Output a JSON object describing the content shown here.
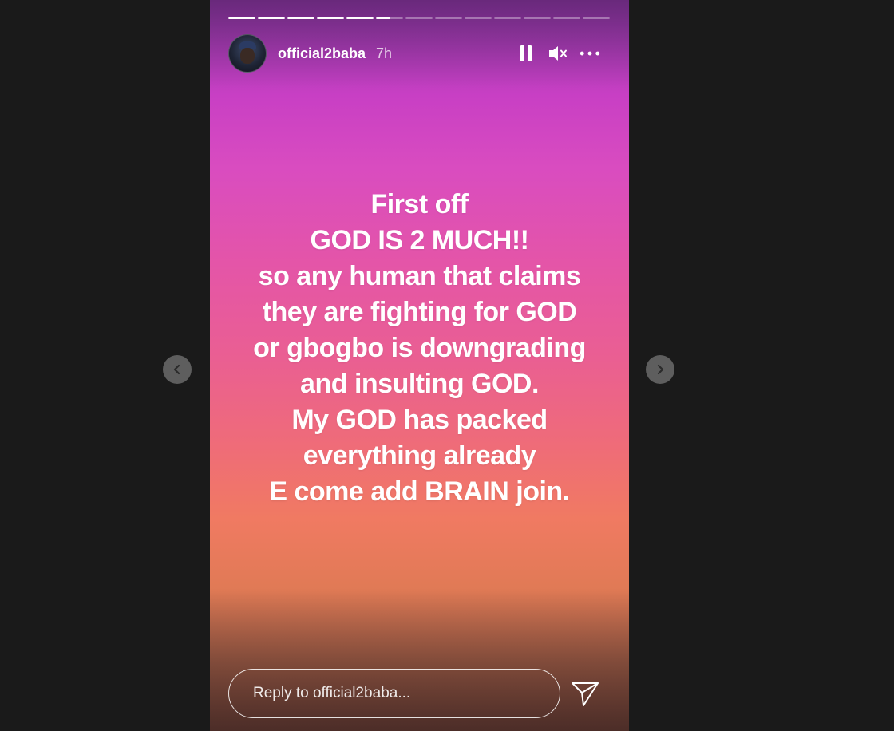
{
  "story": {
    "username": "official2baba",
    "time": "7h",
    "progress": {
      "segments": 13,
      "completed": 5,
      "current_fraction": 0.5
    },
    "text_lines": [
      "First off",
      "GOD IS 2 MUCH!!",
      "so any human that claims",
      "they are fighting for GOD",
      "or gbogbo is downgrading",
      "and insulting GOD.",
      "My GOD has packed",
      "everything already",
      "E come add BRAIN join."
    ],
    "background_colors": [
      "#c83fc4",
      "#ea5f92",
      "#f07a62"
    ]
  },
  "controls": {
    "pause_icon": "pause-icon",
    "mute_icon": "volume-muted-icon",
    "more_icon": "more-options-icon"
  },
  "reply": {
    "placeholder": "Reply to official2baba...",
    "send_icon": "send-icon"
  },
  "navigation": {
    "prev_icon": "chevron-left-icon",
    "next_icon": "chevron-right-icon"
  }
}
